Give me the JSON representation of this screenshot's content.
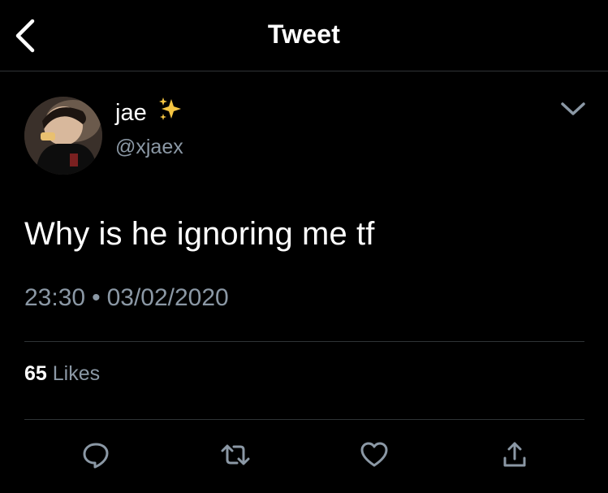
{
  "header": {
    "title": "Tweet",
    "back_icon": "chevron-left-icon"
  },
  "tweet": {
    "author_name": "jae",
    "author_emoji": "sparkles-icon",
    "author_handle": "@xjaex",
    "text": "Why is he ignoring me tf",
    "time": "23:30",
    "separator": "•",
    "date": "03/02/2020",
    "likes_count": "65",
    "likes_label": "Likes",
    "menu_icon": "chevron-down-icon"
  },
  "actions": [
    {
      "name": "reply",
      "icon": "reply-icon"
    },
    {
      "name": "retweet",
      "icon": "retweet-icon"
    },
    {
      "name": "like",
      "icon": "heart-icon"
    },
    {
      "name": "share",
      "icon": "share-icon"
    }
  ],
  "colors": {
    "background": "#000000",
    "text_primary": "#ffffff",
    "text_secondary": "#8b98a5",
    "divider": "#2f3336",
    "sparkle": "#f5c542"
  }
}
